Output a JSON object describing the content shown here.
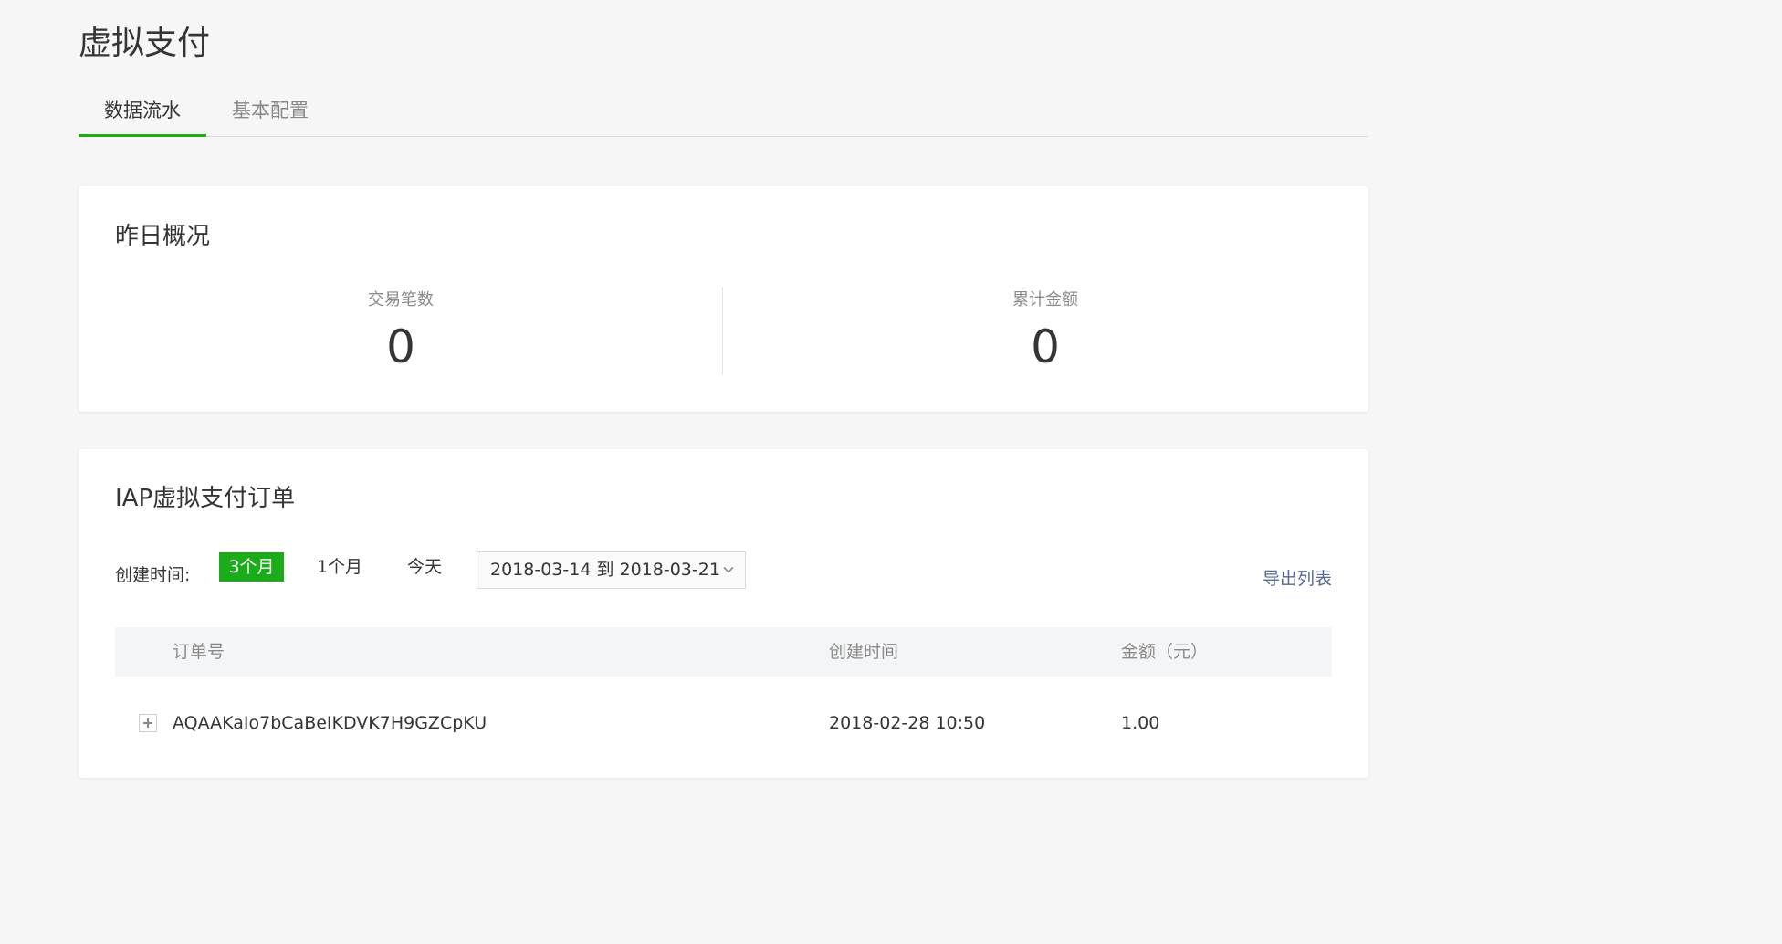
{
  "header": {
    "title": "虚拟支付"
  },
  "tabs": [
    {
      "label": "数据流水",
      "active": true
    },
    {
      "label": "基本配置",
      "active": false
    }
  ],
  "overview": {
    "title": "昨日概况",
    "stats": [
      {
        "label": "交易笔数",
        "value": "0"
      },
      {
        "label": "累计金额",
        "value": "0"
      }
    ]
  },
  "orders": {
    "title": "IAP虚拟支付订单",
    "filter": {
      "label": "创建时间:",
      "ranges": [
        "3个月",
        "1个月",
        "今天"
      ],
      "active_range": "3个月",
      "date_range": "2018-03-14 到 2018-03-21"
    },
    "export_label": "导出列表",
    "columns": [
      "订单号",
      "创建时间",
      "金额（元）"
    ],
    "rows": [
      {
        "order_id": "AQAAKaIo7bCaBeIKDVK7H9GZCpKU",
        "created": "2018-02-28 10:50",
        "amount": "1.00"
      }
    ]
  },
  "colors": {
    "accent": "#1aad19",
    "link": "#576b95",
    "background": "#f6f6f6"
  },
  "icons": {
    "date_select": "chevron-down-icon",
    "row_expand": "expand-plus-icon"
  }
}
